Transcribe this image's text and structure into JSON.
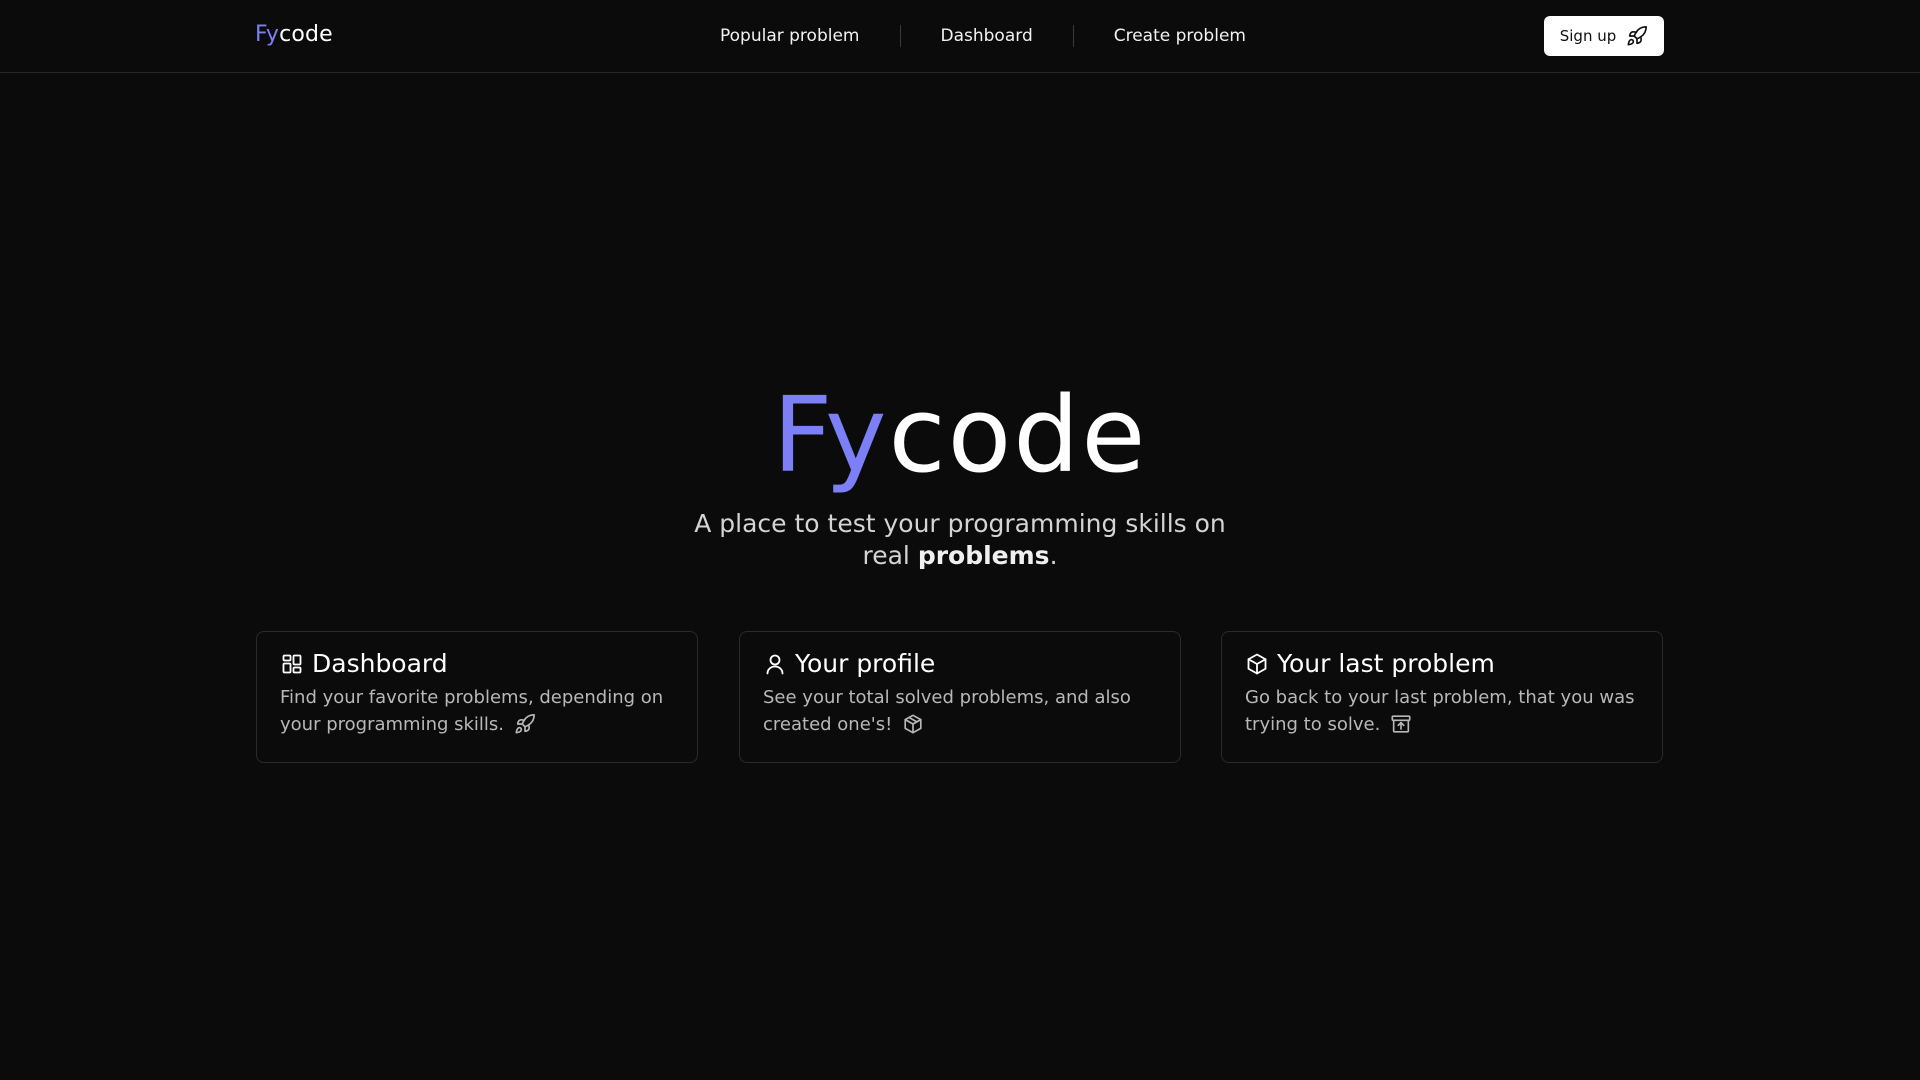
{
  "header": {
    "logo": {
      "accent": "Fy",
      "rest": "code"
    },
    "nav": [
      {
        "label": "Popular problem"
      },
      {
        "label": "Dashboard"
      },
      {
        "label": "Create problem"
      }
    ],
    "signup": {
      "label": "Sign up",
      "icon": "rocket-icon"
    }
  },
  "hero": {
    "title_accent": "Fy",
    "title_rest": "code",
    "subtitle_prefix": "A place to test your programming skills on real",
    "subtitle_bold": "problems",
    "subtitle_suffix": "."
  },
  "cards": [
    {
      "title": "Dashboard",
      "description": "Find your favorite problems, depending on your programming skills.",
      "icon": "dashboard-icon",
      "inline_icon": "rocket-icon"
    },
    {
      "title": "Your profile",
      "description": "See your total solved problems, and also created one's!",
      "icon": "user-icon",
      "inline_icon": "package-icon"
    },
    {
      "title": "Your last problem",
      "description": "Go back to your last problem, that you was trying to solve.",
      "icon": "package-icon",
      "inline_icon": "archive-icon"
    }
  ],
  "colors": {
    "background": "#0b0b0b",
    "accent": "#7c7ff5",
    "text": "#ffffff",
    "muted_text": "#b8b8b8",
    "border": "#2a2a2a"
  }
}
